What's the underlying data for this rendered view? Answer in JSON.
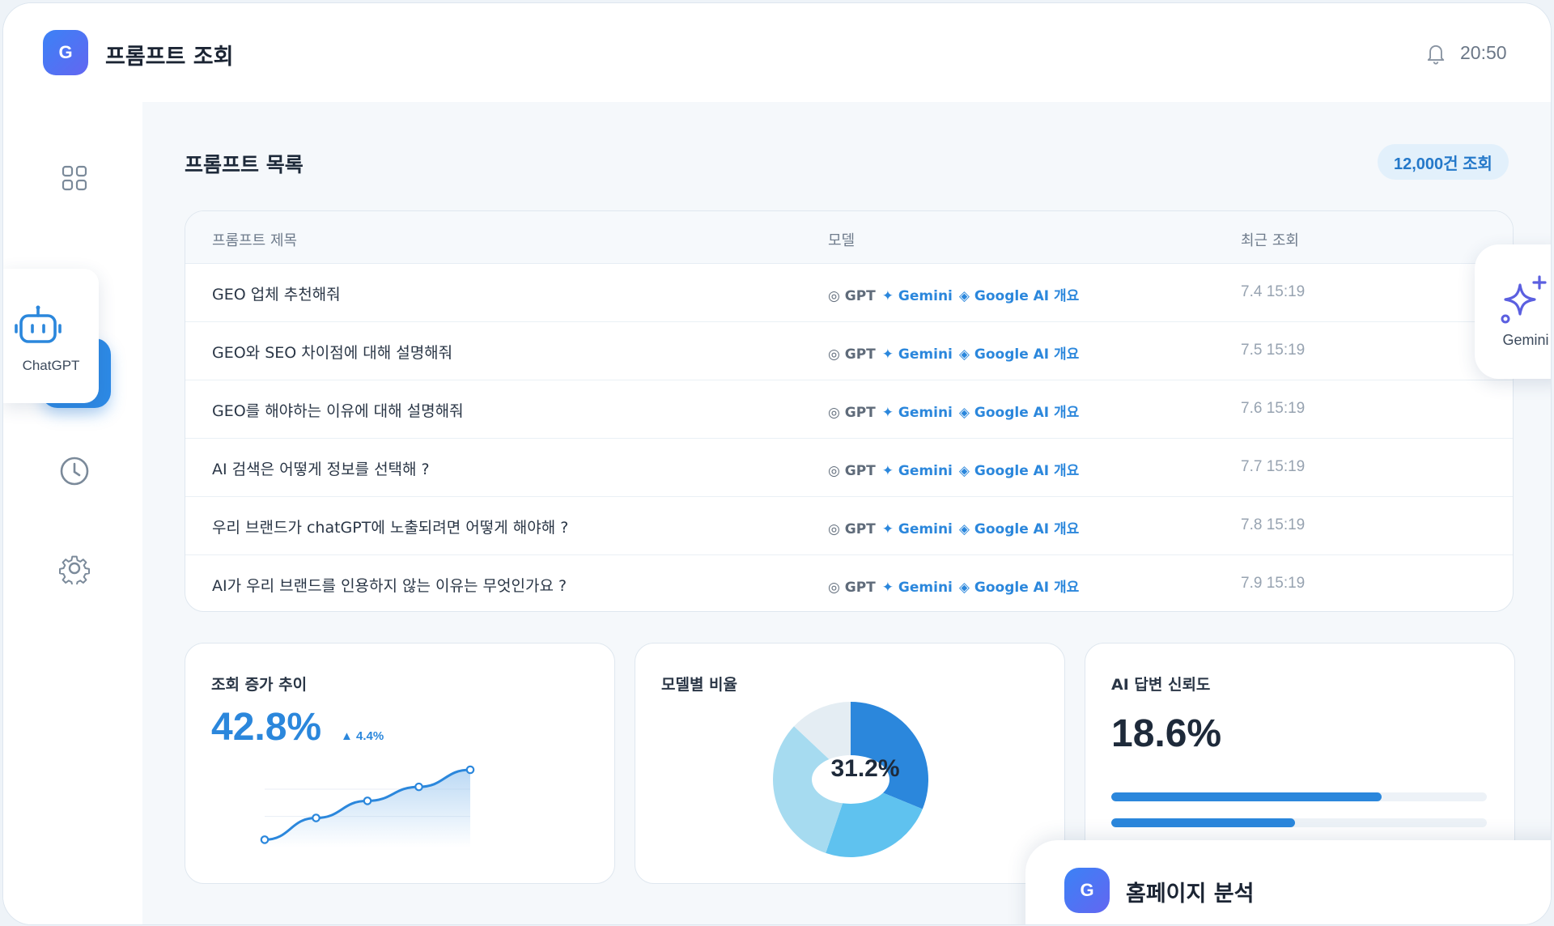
{
  "header": {
    "logo_letter": "G",
    "title": "프롬프트 조회",
    "time": "20:50"
  },
  "sidebar": {
    "floating_bot_label": "ChatGPT",
    "items": [
      {
        "icon": "dashboard-grid-icon"
      },
      {
        "icon": "document-icon",
        "active": true
      },
      {
        "icon": "trend-up-icon"
      },
      {
        "icon": "history-clock-icon"
      },
      {
        "icon": "settings-gear-icon"
      }
    ]
  },
  "main": {
    "section_title": "프롬프트 목록",
    "count_badge": "12,000건 조회",
    "table": {
      "headers": [
        "프롬프트 제목",
        "모델",
        "최근 조회"
      ],
      "model_labels": {
        "gpt": "◎ GPT",
        "gemini": "✦ Gemini",
        "google": "◈ Google AI 개요"
      },
      "rows": [
        {
          "title": "GEO 업체 추천해줘",
          "date": "7.4 15:19"
        },
        {
          "title": "GEO와 SEO 차이점에 대해 설명해줘",
          "date": "7.5 15:19"
        },
        {
          "title": "GEO를 해야하는 이유에 대해 설명해줘",
          "date": "7.6 15:19"
        },
        {
          "title": "AI 검색은 어떻게 정보를 선택해 ?",
          "date": "7.7 15:19"
        },
        {
          "title": "우리 브랜드가 chatGPT에 노출되려면 어떻게 해야해 ?",
          "date": "7.8 15:19"
        },
        {
          "title": "AI가 우리 브랜드를 인용하지 않는 이유는 무엇인가요 ?",
          "date": "7.9 15:19"
        }
      ]
    },
    "cards": {
      "trend": {
        "title": "조회 증가 추이",
        "value": "42.8%",
        "delta": "▲ 4.4%"
      },
      "model_ratio": {
        "title": "모델별 비율",
        "center_label": "31.2%"
      },
      "reliability": {
        "title": "AI 답변 신뢰도",
        "value": "18.6%"
      }
    }
  },
  "gemini_card": {
    "label": "Gemini"
  },
  "home_card": {
    "logo_letter": "G",
    "title": "홈페이지 분석"
  },
  "colors": {
    "accent": "#2b87dc",
    "active_tab": "#2d8ae6",
    "gpt_gray": "#5f6b7a"
  },
  "chart_data": [
    {
      "type": "line",
      "x": [
        1,
        2,
        3,
        4,
        5
      ],
      "y": [
        10,
        38,
        60,
        78,
        100
      ],
      "ylim": [
        0,
        100
      ],
      "title": "",
      "xlabel": "",
      "ylabel": "",
      "grid": true
    },
    {
      "type": "pie",
      "values": [
        31.2,
        24.0,
        31.8,
        13.0
      ],
      "colors": [
        "#2b87dc",
        "#5fc2ef",
        "#a6dbf0",
        "#e4edf3"
      ],
      "title": ""
    },
    {
      "type": "bar",
      "orientation": "horizontal",
      "values": [
        72,
        49
      ],
      "max": 100,
      "title": ""
    }
  ]
}
